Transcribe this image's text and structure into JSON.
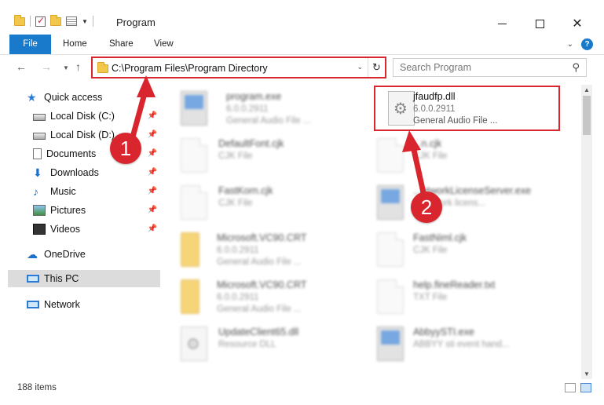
{
  "window": {
    "title": "Program",
    "minimize": "",
    "maximize": "",
    "close": "✕"
  },
  "ribbon": {
    "tabs": [
      {
        "label": "File"
      },
      {
        "label": "Home"
      },
      {
        "label": "Share"
      },
      {
        "label": "View"
      }
    ]
  },
  "address": {
    "path": "C:\\Program Files\\Program Directory",
    "search_placeholder": "Search Program"
  },
  "nav_pane": {
    "items": [
      {
        "label": "Quick access",
        "icon": "star-icon"
      },
      {
        "label": "Local Disk (C:)",
        "icon": "disk-icon"
      },
      {
        "label": "Local Disk (D:)",
        "icon": "disk-icon"
      },
      {
        "label": "Documents",
        "icon": "documents-icon"
      },
      {
        "label": "Downloads",
        "icon": "downloads-icon"
      },
      {
        "label": "Music",
        "icon": "music-icon"
      },
      {
        "label": "Pictures",
        "icon": "pictures-icon"
      },
      {
        "label": "Videos",
        "icon": "videos-icon"
      },
      {
        "label": "OneDrive",
        "icon": "cloud-icon"
      },
      {
        "label": "This PC",
        "icon": "computer-icon"
      },
      {
        "label": "Network",
        "icon": "network-icon"
      }
    ]
  },
  "files": [
    {
      "name": "program.exe",
      "sub1": "6.0.0.2911",
      "sub2": "General Audio File ...",
      "icon": "exe-icon"
    },
    {
      "name": "jfaudfp.dll",
      "sub1": "6.0.0.2911",
      "sub2": "General Audio File ...",
      "icon": "dll-icon"
    },
    {
      "name": "DefaultFont.cjk",
      "sub1": "CJK File",
      "sub2": "",
      "icon": "file-icon"
    },
    {
      "name": "...n.cjk",
      "sub1": "CJK File",
      "sub2": "",
      "icon": "file-icon"
    },
    {
      "name": "FastKorn.cjk",
      "sub1": "CJK File",
      "sub2": "",
      "icon": "file-icon"
    },
    {
      "name": "...etworkLicenseServer.exe",
      "sub1": "...network licens...",
      "sub2": "",
      "icon": "exe-icon"
    },
    {
      "name": "Microsoft.VC90.CRT",
      "sub1": "6.0.0.2911",
      "sub2": "General Audio File ...",
      "icon": "folder-icon"
    },
    {
      "name": "FastNiml.cjk",
      "sub1": "CJK File",
      "sub2": "",
      "icon": "file-icon"
    },
    {
      "name": "Microsoft.VC90.CRT",
      "sub1": "6.0.0.2911",
      "sub2": "General Audio File ...",
      "icon": "folder-icon"
    },
    {
      "name": "help.fineReader.txt",
      "sub1": "TXT File",
      "sub2": "",
      "icon": "file-icon"
    },
    {
      "name": "UpdateClient65.dll",
      "sub1": "Resource DLL",
      "sub2": "",
      "icon": "dll-icon"
    },
    {
      "name": "AbbyySTI.exe",
      "sub1": "ABBYY sti event hand...",
      "sub2": "",
      "icon": "exe-icon"
    }
  ],
  "status": {
    "count": "188 items"
  },
  "annotations": {
    "step1": "1",
    "step2": "2",
    "color": "#d9262e"
  }
}
